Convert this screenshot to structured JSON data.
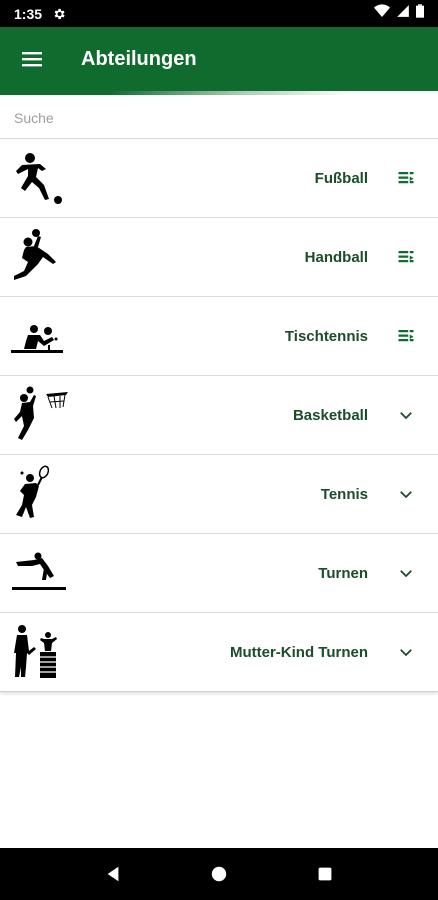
{
  "status_bar": {
    "time": "1:35"
  },
  "app_bar": {
    "title": "Abteilungen"
  },
  "search": {
    "placeholder": "Suche",
    "value": ""
  },
  "departments": [
    {
      "label": "Fußball",
      "icon": "soccer-icon",
      "action": "list-detail-icon"
    },
    {
      "label": "Handball",
      "icon": "handball-icon",
      "action": "list-detail-icon"
    },
    {
      "label": "Tischtennis",
      "icon": "table-tennis-icon",
      "action": "list-detail-icon"
    },
    {
      "label": "Basketball",
      "icon": "basketball-icon",
      "action": "chevron-down-icon"
    },
    {
      "label": "Tennis",
      "icon": "tennis-icon",
      "action": "chevron-down-icon"
    },
    {
      "label": "Turnen",
      "icon": "gymnastics-icon",
      "action": "chevron-down-icon"
    },
    {
      "label": "Mutter-Kind Turnen",
      "icon": "parent-child-gymnastics-icon",
      "action": "chevron-down-icon"
    }
  ],
  "colors": {
    "primary": "#0f6b2e",
    "label_text": "#1b4d2a",
    "status_bar": "#000000"
  }
}
